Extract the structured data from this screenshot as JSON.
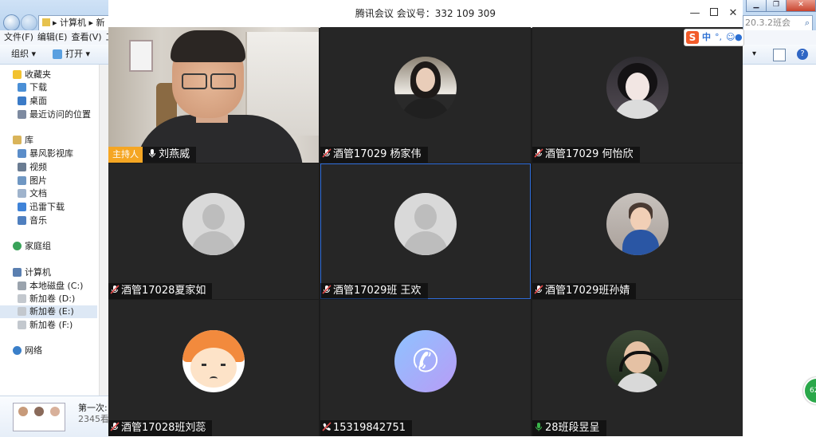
{
  "explorer": {
    "address_crumbs": [
      "计算机",
      "新"
    ],
    "menu": [
      "文件(F)",
      "编辑(E)",
      "查看(V)",
      "工"
    ],
    "toolbar": {
      "organize": "组织 ▾",
      "open": "打开 ▾"
    },
    "sidebar": [
      {
        "label": "收藏夹",
        "group": true
      },
      {
        "label": "下载"
      },
      {
        "label": "桌面"
      },
      {
        "label": "最近访问的位置"
      },
      {
        "label": "库",
        "group": true
      },
      {
        "label": "暴风影视库"
      },
      {
        "label": "视频"
      },
      {
        "label": "图片"
      },
      {
        "label": "文档"
      },
      {
        "label": "迅雷下载"
      },
      {
        "label": "音乐"
      },
      {
        "label": "家庭组",
        "group": true
      },
      {
        "label": "计算机",
        "group": true
      },
      {
        "label": "本地磁盘 (C:)"
      },
      {
        "label": "新加卷 (D:)"
      },
      {
        "label": "新加卷 (E:)",
        "selected": true
      },
      {
        "label": "新加卷 (F:)"
      },
      {
        "label": "网络",
        "group": true
      }
    ],
    "details": {
      "name": "第一次:",
      "sub": "2345看"
    },
    "search_text": "20.3.2班会"
  },
  "meeting": {
    "title": "腾讯会议 会议号：332 109 309",
    "host_badge": "主持人",
    "ime": {
      "logo": "S",
      "lang": "中"
    },
    "participants": [
      {
        "name": "刘燕威",
        "host": true,
        "mic": "on",
        "avatar": "video"
      },
      {
        "name": "酒管17029 杨家伟",
        "mic": "muted",
        "avatar": "woman"
      },
      {
        "name": "酒管17029 何怡欣",
        "mic": "muted",
        "avatar": "anime"
      },
      {
        "name": "酒管17028夏家如",
        "mic": "muted",
        "avatar": "default"
      },
      {
        "name": "酒管17029班 王欢",
        "mic": "muted",
        "avatar": "default",
        "active": true
      },
      {
        "name": "酒管17029班孙婧",
        "mic": "muted",
        "avatar": "kid"
      },
      {
        "name": "酒管17028班刘蕊",
        "mic": "muted",
        "avatar": "cartoon"
      },
      {
        "name": "15319842751",
        "mic": "phone",
        "avatar": "phone"
      },
      {
        "name": "28班段昱呈",
        "mic": "on-green",
        "avatar": "boy"
      }
    ]
  },
  "colors": {
    "accent_blue": "#2e6ddc",
    "host_orange": "#f5a623",
    "tile_bg": "#262626",
    "mic_green": "#3ab54a",
    "mic_muted": "#e24a4a"
  }
}
